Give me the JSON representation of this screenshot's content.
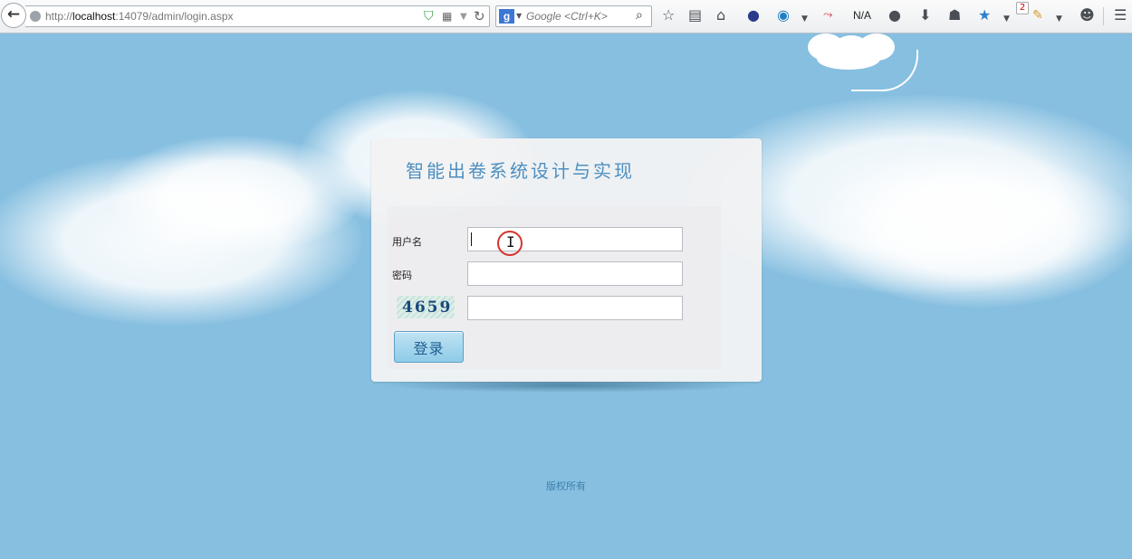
{
  "browser": {
    "url_prefix": "http://",
    "url_host": "localhost",
    "url_rest": ":14079/admin/login.aspx",
    "search_placeholder": "Google <Ctrl+K>",
    "na_label": "N/A",
    "notification_count": "2",
    "icons": {
      "back": "back-arrow-icon",
      "site": "globe-icon",
      "shield": "shield-icon",
      "qr": "qr-code-icon",
      "reload": "reload-icon",
      "search_engine": "google-icon",
      "search_go": "search-icon",
      "bookmark": "star-icon",
      "reading_list": "clipboard-icon",
      "home": "home-icon",
      "menu": "hamburger-menu-icon"
    }
  },
  "login": {
    "title": "智能出卷系统设计与实现",
    "username_label": "用户名",
    "password_label": "密码",
    "username_value": "",
    "password_value": "",
    "captcha_text": "4659",
    "captcha_value": "",
    "submit_label": "登录"
  },
  "footer": {
    "copyright": "版权所有"
  },
  "colors": {
    "page_background": "#86bfe0",
    "title_color": "#4d8fc0",
    "button_gradient_top": "#bfe3f3",
    "button_gradient_bottom": "#8fcbe8",
    "footer_text": "#3f7fae"
  }
}
